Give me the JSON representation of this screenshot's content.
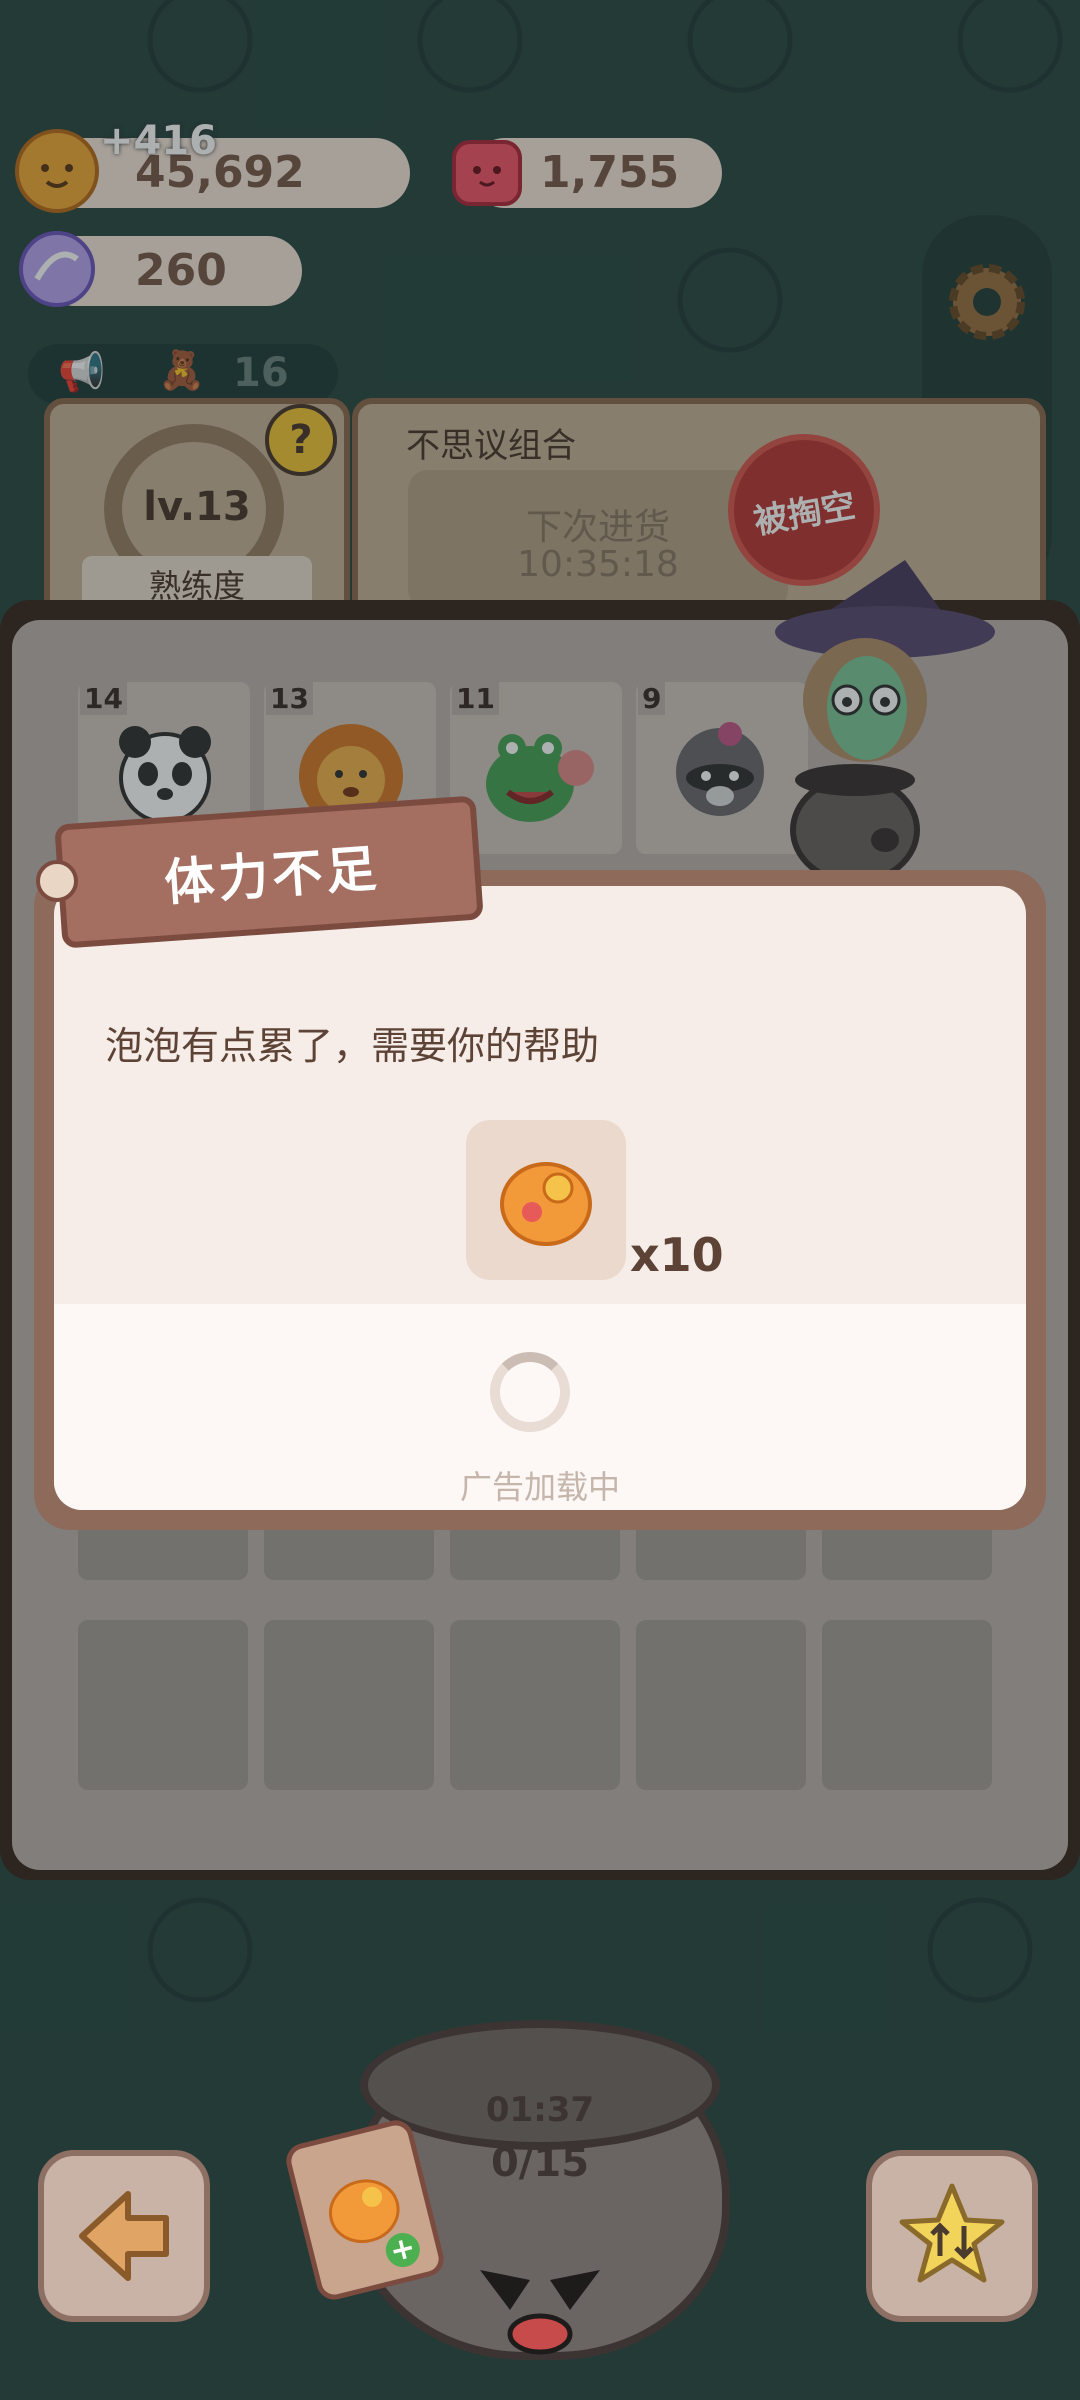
{
  "resources": {
    "cookies": {
      "value": "45,692",
      "gain": "+416"
    },
    "gems": {
      "value": "1,755"
    },
    "candy": {
      "value": "260"
    }
  },
  "notice": {
    "count": "16"
  },
  "level_panel": {
    "level": "lv.13",
    "label": "熟练度",
    "help": "?"
  },
  "shop_panel": {
    "title": "不思议组合",
    "restock_label": "下次进货",
    "restock_time": "10:35:18",
    "stamp": "被掏空"
  },
  "cards": [
    {
      "num": "14",
      "name": "panda"
    },
    {
      "num": "13",
      "name": "lion"
    },
    {
      "num": "11",
      "name": "frog"
    },
    {
      "num": "9",
      "name": "raccoon"
    }
  ],
  "dialog": {
    "title": "体力不足",
    "message": "泡泡有点累了，需要你的帮助",
    "reward_qty": "x10",
    "loading_text": "广告加载中"
  },
  "pot": {
    "timer": "01:37",
    "progress": "0/15"
  },
  "icons": {
    "back": "back-arrow-icon",
    "swap": "star-swap-icon",
    "settings": "gear-icon"
  },
  "colors": {
    "background": "#2b4a46",
    "dialog_bg": "#f6ede8",
    "tag": "#a46e60",
    "text": "#5d4336"
  }
}
